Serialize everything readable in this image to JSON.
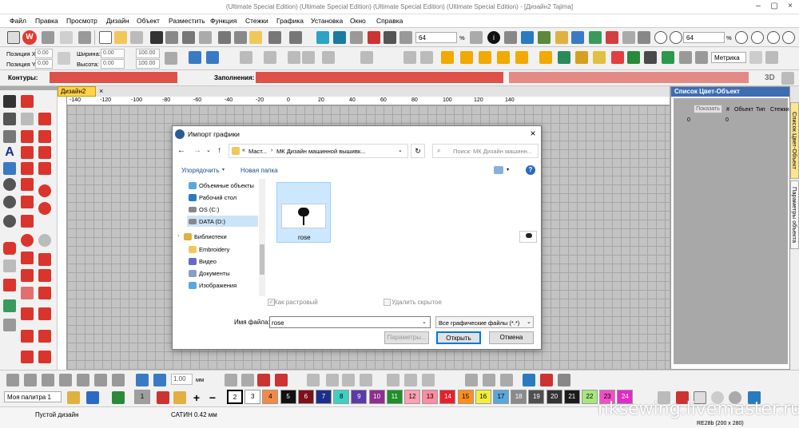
{
  "window": {
    "title": "(Ultimate Special Edition) (Ultimate Special Edition) (Ultimate Special Edition) (Ultimate Special Edition) - [Дизайн2        Tajima]"
  },
  "menu": [
    "Файл",
    "Правка",
    "Просмотр",
    "Дизайн",
    "Объект",
    "Разместить",
    "Функция",
    "Стежки",
    "Графика",
    "Установка",
    "Окно",
    "Справка"
  ],
  "toolbar1": {
    "zoom_value": "64",
    "zoom_unit": "%",
    "zoom2_value": "64",
    "zoom2_unit": "%"
  },
  "toolbar2": {
    "pos_x_label": "Позиция X:",
    "pos_x_value": "0.00",
    "pos_y_label": "Позиция Y:",
    "pos_y_value": "0.00",
    "width_label": "Ширина:",
    "width_value": "0.00",
    "width_pct": "100.00",
    "height_label": "Высота:",
    "height_value": "0.00",
    "height_pct": "100.00",
    "metric": "Метрика"
  },
  "toolbar3": {
    "contours_label": "Контуры:",
    "fills_label": "Заполнения:",
    "view3d": "3D"
  },
  "document": {
    "tab": "Дизайн2",
    "ruler": [
      "-140",
      "-120",
      "-100",
      "-80",
      "-60",
      "-40",
      "-20",
      "0",
      "20",
      "40",
      "60",
      "80",
      "100",
      "120",
      "140"
    ]
  },
  "right_panel": {
    "title": "Список Цвет-Объект",
    "show_btn": "Показать",
    "col_num": "#",
    "col_object": "Объект",
    "col_type": "Тип",
    "col_stitches": "Стежки",
    "row_a": "0",
    "row_b": "0",
    "vtab1": "Список Цвет-Объект",
    "vtab2": "Параметры объекта"
  },
  "dialog": {
    "title": "Импорт графики",
    "breadcrumb": [
      "Маст...",
      "МК Дизайн машинной вышивк..."
    ],
    "search_placeholder": "Поиск: МК Дизайн машинн...",
    "organize": "Упорядочить",
    "new_folder": "Новая папка",
    "nav": [
      "Объемные объекты",
      "Рабочий стол",
      "OS (C:)",
      "DATA (D:)",
      "Библиотеки",
      "Embroidery",
      "Видео",
      "Документы",
      "Изображения"
    ],
    "file_name": "rose",
    "as_raster": "Как растровый",
    "remove_hidden": "Удалить скрытое",
    "filename_label": "Имя файла:",
    "filename_value": "rose",
    "filetype": "Все графические файлы (*.*)",
    "params_btn": "Параметры...",
    "open_btn": "Открыть",
    "cancel_btn": "Отмена"
  },
  "bottom": {
    "thickness": "1.00",
    "thickness_unit": "мм",
    "palette": "Моя палитра 1"
  },
  "palette": [
    {
      "n": "1",
      "c": "#9e9e9e"
    },
    {
      "n": "2",
      "c": "#ffffff"
    },
    {
      "n": "3",
      "c": "#ffffff"
    },
    {
      "n": "4",
      "c": "#f28a46"
    },
    {
      "n": "5",
      "c": "#111111"
    },
    {
      "n": "6",
      "c": "#7d1019"
    },
    {
      "n": "7",
      "c": "#1b2f8a"
    },
    {
      "n": "8",
      "c": "#3ecfc2"
    },
    {
      "n": "9",
      "c": "#5d3aa8"
    },
    {
      "n": "10",
      "c": "#8e2e8e"
    },
    {
      "n": "11",
      "c": "#1f8f2a"
    },
    {
      "n": "12",
      "c": "#ff9fb2"
    },
    {
      "n": "13",
      "c": "#ff8ca0"
    },
    {
      "n": "14",
      "c": "#e8202a"
    },
    {
      "n": "15",
      "c": "#ff8e1a"
    },
    {
      "n": "16",
      "c": "#f3ee3c"
    },
    {
      "n": "17",
      "c": "#5aa7dc"
    },
    {
      "n": "18",
      "c": "#8a8a8a"
    },
    {
      "n": "19",
      "c": "#4f4f4f"
    },
    {
      "n": "20",
      "c": "#333333"
    },
    {
      "n": "21",
      "c": "#1a1a1a"
    },
    {
      "n": "22",
      "c": "#a6e87a"
    },
    {
      "n": "23",
      "c": "#f24ec8"
    },
    {
      "n": "24",
      "c": "#e22bc7"
    }
  ],
  "status": {
    "left": "Пустой дизайн",
    "mid": "САТИН  0.42 мм",
    "right": "RE28b (200 x 280)"
  },
  "watermark": "nksewing.livemaster.ru"
}
